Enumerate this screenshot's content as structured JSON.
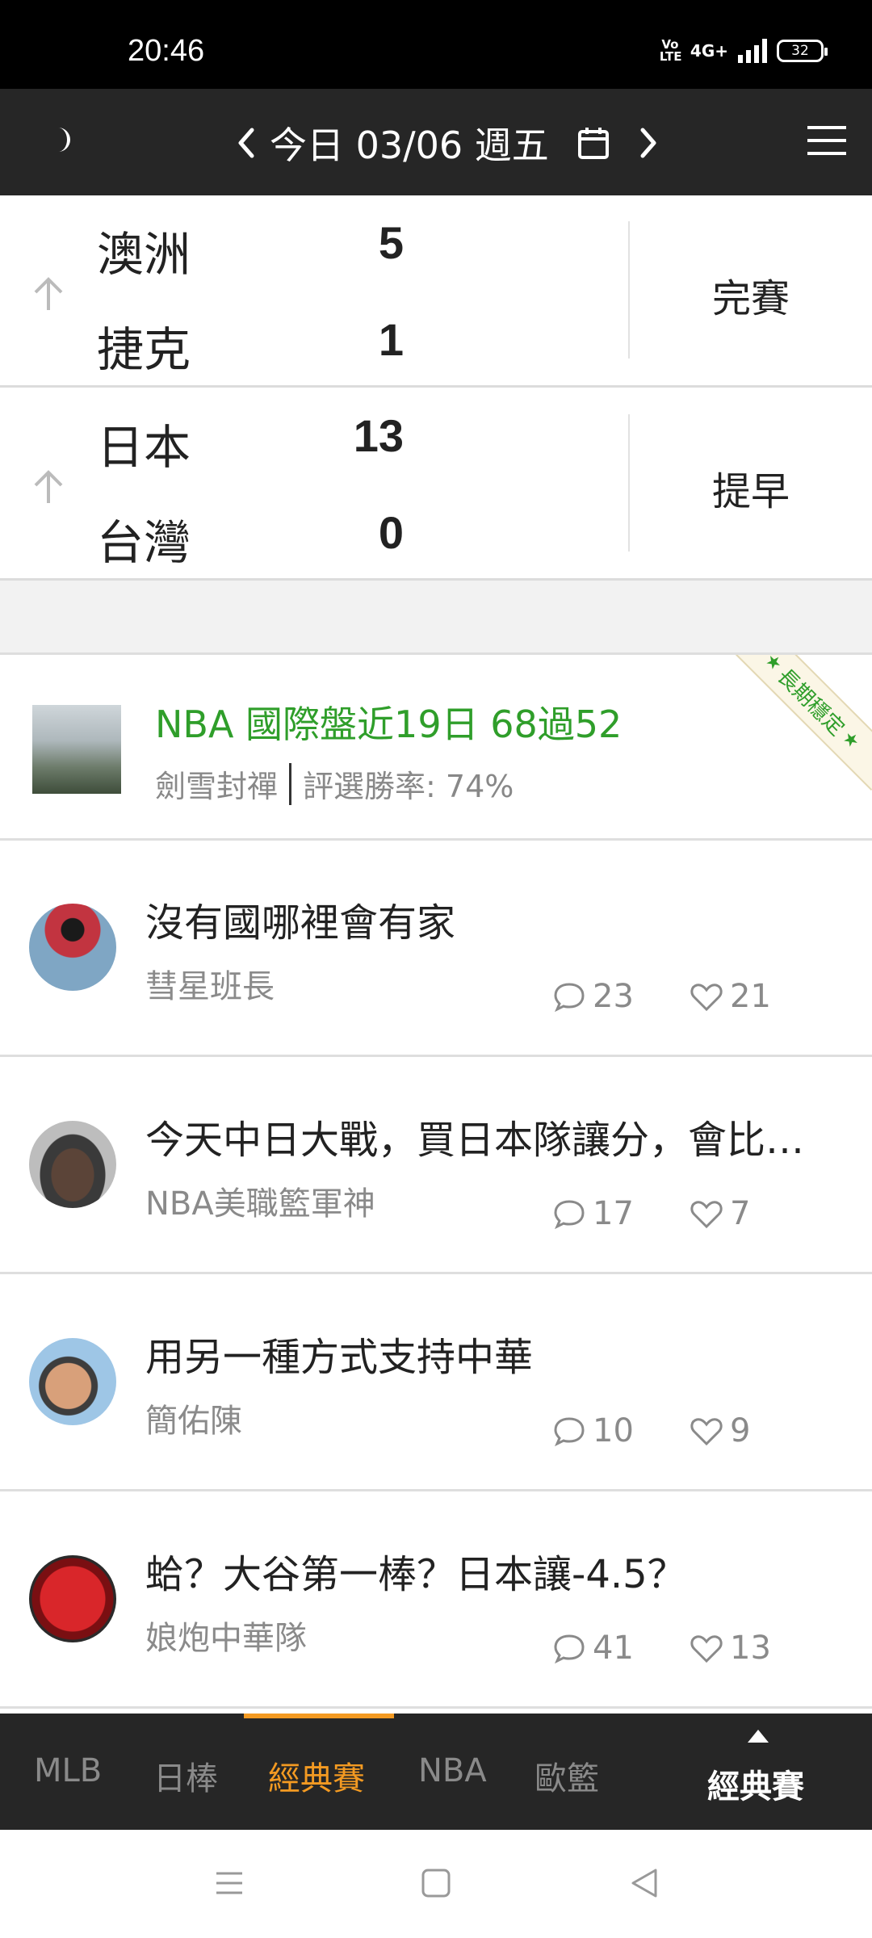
{
  "status_bar": {
    "time": "20:46",
    "volte": "Vo LTE",
    "network": "4G+",
    "battery": "32"
  },
  "header": {
    "date_label": "今日 03/06 週五",
    "icons": [
      "moon-icon",
      "chevron-left-icon",
      "calendar-icon",
      "chevron-right-icon",
      "hamburger-menu-icon"
    ]
  },
  "matches": [
    {
      "home": "澳洲",
      "home_score": "5",
      "away": "捷克",
      "away_score": "1",
      "status": "完賽"
    },
    {
      "home": "日本",
      "home_score": "13",
      "away": "台灣",
      "away_score": "0",
      "status": "提早"
    }
  ],
  "featured": {
    "title": "NBA 國際盤近19日 68過52",
    "author": "劍雪封禪",
    "win_rate": "評選勝率: 74%",
    "ribbon": "長期穩定"
  },
  "posts": [
    {
      "title": "沒有國哪裡會有家",
      "author": "彗星班長",
      "comments": "23",
      "likes": "21"
    },
    {
      "title": "今天中日大戰，買日本隊讓分，會比買...",
      "author": "NBA美職籃軍神",
      "comments": "17",
      "likes": "7"
    },
    {
      "title": "用另一種方式支持中華",
      "author": "簡佑陳",
      "comments": "10",
      "likes": "9"
    },
    {
      "title": "蛤？大谷第一棒？日本讓-4.5？",
      "author": "娘炮中華隊",
      "comments": "41",
      "likes": "13"
    }
  ],
  "tabs": [
    "MLB",
    "日棒",
    "經典賽",
    "NBA",
    "歐籃"
  ],
  "active_tab": "經典賽",
  "current_section": "經典賽",
  "colors": {
    "accent": "#f39a22",
    "featured_green": "#2f9e2a",
    "header_bg": "#262626"
  }
}
